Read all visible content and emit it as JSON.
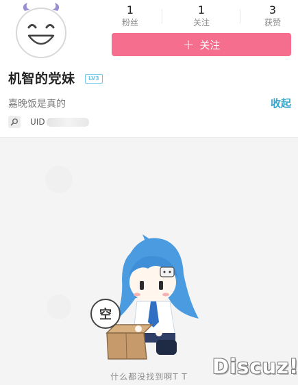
{
  "stats": [
    {
      "value": "1",
      "label": "粉丝"
    },
    {
      "value": "1",
      "label": "关注"
    },
    {
      "value": "3",
      "label": "获赞"
    }
  ],
  "follow_button": {
    "icon": "+",
    "label": "关注"
  },
  "user": {
    "name": "机智的党妹",
    "level": "LV3",
    "bio": "嘉晚饭是真的",
    "uid_label": "UID"
  },
  "collapse_label": "收起",
  "empty_state": {
    "bubble_text": "空",
    "message": "什么都没找到啊T T"
  },
  "watermark": "Discuz!",
  "colors": {
    "accent_pink": "#f56e8d",
    "link_blue": "#3aa3c8",
    "level_blue": "#6ec6ef",
    "avatar_purple": "#9b8fd4"
  },
  "icons": {
    "avatar": "smiling-face-avatar",
    "uid": "search-icon"
  }
}
